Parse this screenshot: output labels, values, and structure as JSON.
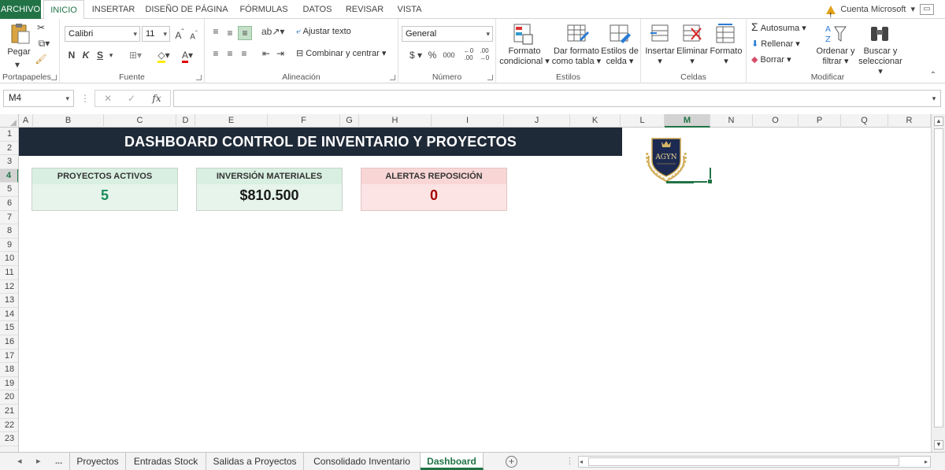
{
  "ribbon_tabs": [
    "ARCHIVO",
    "INICIO",
    "INSERTAR",
    "DISEÑO DE PÁGINA",
    "FÓRMULAS",
    "DATOS",
    "REVISAR",
    "VISTA"
  ],
  "account": "Cuenta Microsoft",
  "clipboard": {
    "paste": "Pegar",
    "label": "Portapapeles"
  },
  "font": {
    "name": "Calibri",
    "size": "11",
    "bold": "N",
    "italic": "K",
    "underline": "S",
    "label": "Fuente"
  },
  "alignment": {
    "wrap": "Ajustar texto",
    "merge": "Combinar y centrar",
    "label": "Alineación"
  },
  "number": {
    "format": "General",
    "currency": "$",
    "percent": "%",
    "thousands": "000",
    "label": "Número"
  },
  "styles": {
    "cond1": "Formato",
    "cond2": "condicional",
    "table1": "Dar formato",
    "table2": "como tabla",
    "cell1": "Estilos de",
    "cell2": "celda",
    "label": "Estilos"
  },
  "cells": {
    "insert": "Insertar",
    "delete": "Eliminar",
    "format": "Formato",
    "label": "Celdas"
  },
  "editing": {
    "autosum": "Autosuma",
    "fill": "Rellenar",
    "clear": "Borrar",
    "sort1": "Ordenar y",
    "sort2": "filtrar",
    "find1": "Buscar y",
    "find2": "seleccionar",
    "label": "Modificar"
  },
  "formula_bar": {
    "name_box": "M4",
    "fx": "fx",
    "formula": ""
  },
  "columns": [
    "A",
    "B",
    "C",
    "D",
    "E",
    "F",
    "G",
    "H",
    "I",
    "J",
    "K",
    "L",
    "M",
    "N",
    "O",
    "P",
    "Q",
    "R"
  ],
  "selected_column": "M",
  "rows": [
    "1",
    "2",
    "3",
    "4",
    "5",
    "6",
    "7",
    "8",
    "9",
    "10",
    "11",
    "12",
    "13",
    "14",
    "15",
    "16",
    "17",
    "18",
    "19",
    "20",
    "21",
    "22",
    "23"
  ],
  "selected_row": "4",
  "dashboard": {
    "title": "DASHBOARD CONTROL DE INVENTARIO Y PROYECTOS",
    "logo_text": "AGYN",
    "kpis": [
      {
        "label": "PROYECTOS ACTIVOS",
        "value": "5",
        "color": "#1a8a5a"
      },
      {
        "label": "INVERSIÓN MATERIALES",
        "value": "$810.500",
        "color": "#1a1a1a"
      },
      {
        "label": "ALERTAS REPOSICIÓN",
        "value": "0",
        "color": "#a40000"
      }
    ]
  },
  "sheet_tabs": {
    "more": "...",
    "items": [
      "Proyectos",
      "Entradas Stock",
      "Salidas a Proyectos",
      "Consolidado Inventario",
      "Dashboard"
    ],
    "active": "Dashboard"
  },
  "colors": {
    "accent": "#217346",
    "title_bg": "#1f2a38"
  }
}
